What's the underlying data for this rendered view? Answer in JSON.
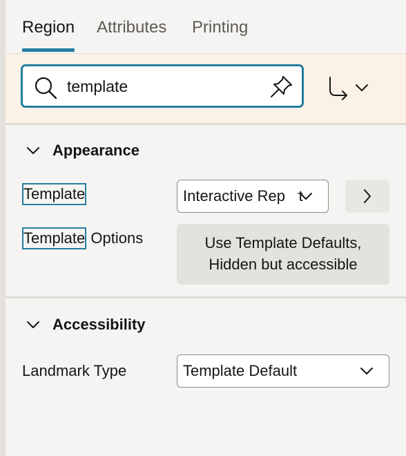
{
  "tabs": [
    {
      "label": "Region",
      "active": true
    },
    {
      "label": "Attributes",
      "active": false
    },
    {
      "label": "Printing",
      "active": false
    }
  ],
  "search": {
    "value": "template",
    "icon": "search-icon",
    "pin_icon": "pin-icon",
    "goto_icon": "goto-arrow-icon"
  },
  "sections": {
    "appearance": {
      "title": "Appearance",
      "expanded": true,
      "template": {
        "label_highlight": "Template",
        "select_value": "Interactive Report"
      },
      "template_options": {
        "label_highlight": "Template",
        "label_rest": " Options",
        "value_line1": "Use Template Defaults,",
        "value_line2": "Hidden but accessible"
      }
    },
    "accessibility": {
      "title": "Accessibility",
      "expanded": true,
      "landmark_type": {
        "label": "Landmark Type",
        "select_value": "Template Default"
      }
    }
  },
  "colors": {
    "accent": "#227e9e",
    "search_band": "#fcf1e6",
    "panel_bg": "#f5f4f2",
    "button_bg": "#e9e7e3"
  }
}
